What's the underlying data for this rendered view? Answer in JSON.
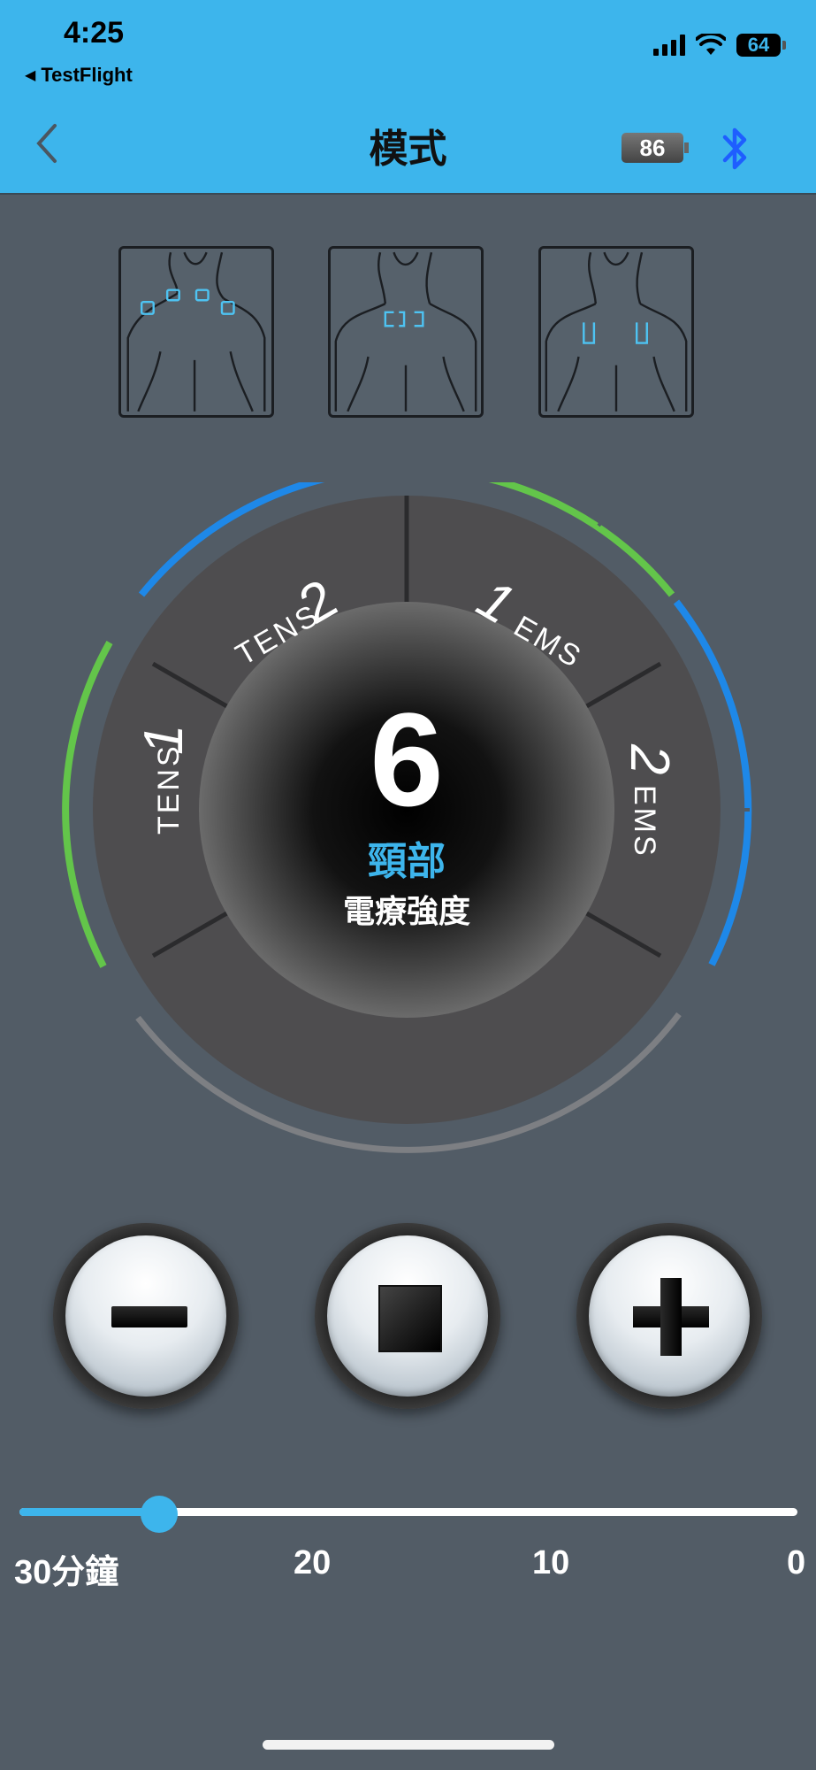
{
  "status_bar": {
    "time": "4:25",
    "back_app": "TestFlight",
    "battery_level": "64"
  },
  "nav": {
    "title": "模式",
    "device_battery": "86",
    "colors": {
      "bar": "#3db5ec",
      "bluetooth": "#1e5eff"
    }
  },
  "zones": [
    {
      "name": "zone-upper-shoulders",
      "selected": false
    },
    {
      "name": "zone-neck",
      "selected": true
    },
    {
      "name": "zone-upper-back",
      "selected": false
    }
  ],
  "dial": {
    "intensity": "6",
    "body_part": "頸部",
    "label": "電療強度",
    "segments": [
      {
        "num": "1",
        "type": "TENS"
      },
      {
        "num": "2",
        "type": "TENS"
      },
      {
        "num": "1",
        "type": "EMS"
      },
      {
        "num": "2",
        "type": "EMS"
      }
    ],
    "colors": {
      "green": "#63c54a",
      "blue": "#1e88e8",
      "gray": "#7d7f83"
    }
  },
  "controls": {
    "minus_icon": "minus-icon",
    "stop_icon": "stop-icon",
    "plus_icon": "plus-icon"
  },
  "timer": {
    "position_fraction": 0.18,
    "labels": [
      "30分鐘",
      "20",
      "10",
      "0"
    ]
  }
}
